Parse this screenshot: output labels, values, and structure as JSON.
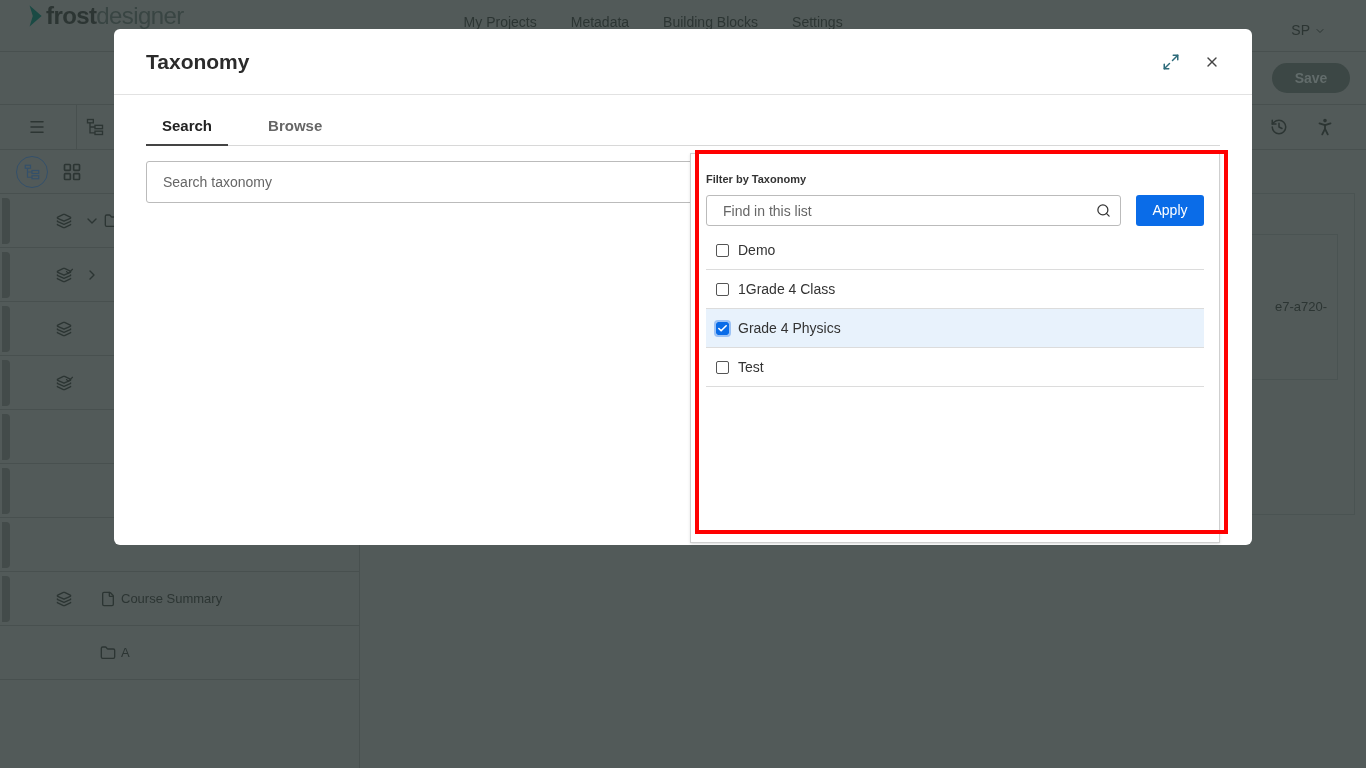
{
  "app": {
    "logo": {
      "first": "frost",
      "second": "designer"
    },
    "nav": [
      "My Projects",
      "Metadata",
      "Building Blocks",
      "Settings"
    ],
    "user": "SP",
    "save": "Save",
    "outline": [
      {
        "kind": "folder",
        "reviewed": false,
        "expanded": true
      },
      {
        "kind": "group",
        "reviewed": true,
        "expanded": false
      },
      {
        "kind": "blank",
        "reviewed": false
      },
      {
        "kind": "blank",
        "reviewed": true
      },
      {
        "kind": "empty"
      },
      {
        "kind": "empty"
      },
      {
        "kind": "empty"
      },
      {
        "kind": "page",
        "reviewed": false,
        "label": "Course Summary"
      },
      {
        "kind": "folder",
        "label": "A"
      }
    ],
    "content_text": "e7-a720-"
  },
  "dialog": {
    "title": "Taxonomy",
    "tabs": [
      {
        "label": "Search",
        "selected": true
      },
      {
        "label": "Browse",
        "selected": false
      }
    ],
    "search": {
      "placeholder": "Search taxonomy"
    },
    "filter": {
      "title": "Filter by Taxonomy",
      "find": {
        "placeholder": "Find in this list"
      },
      "apply": "Apply",
      "options": [
        {
          "label": "Demo",
          "checked": false
        },
        {
          "label": "1Grade 4 Class",
          "checked": false
        },
        {
          "label": "Grade 4 Physics",
          "checked": true
        },
        {
          "label": "Test",
          "checked": false
        }
      ]
    }
  }
}
